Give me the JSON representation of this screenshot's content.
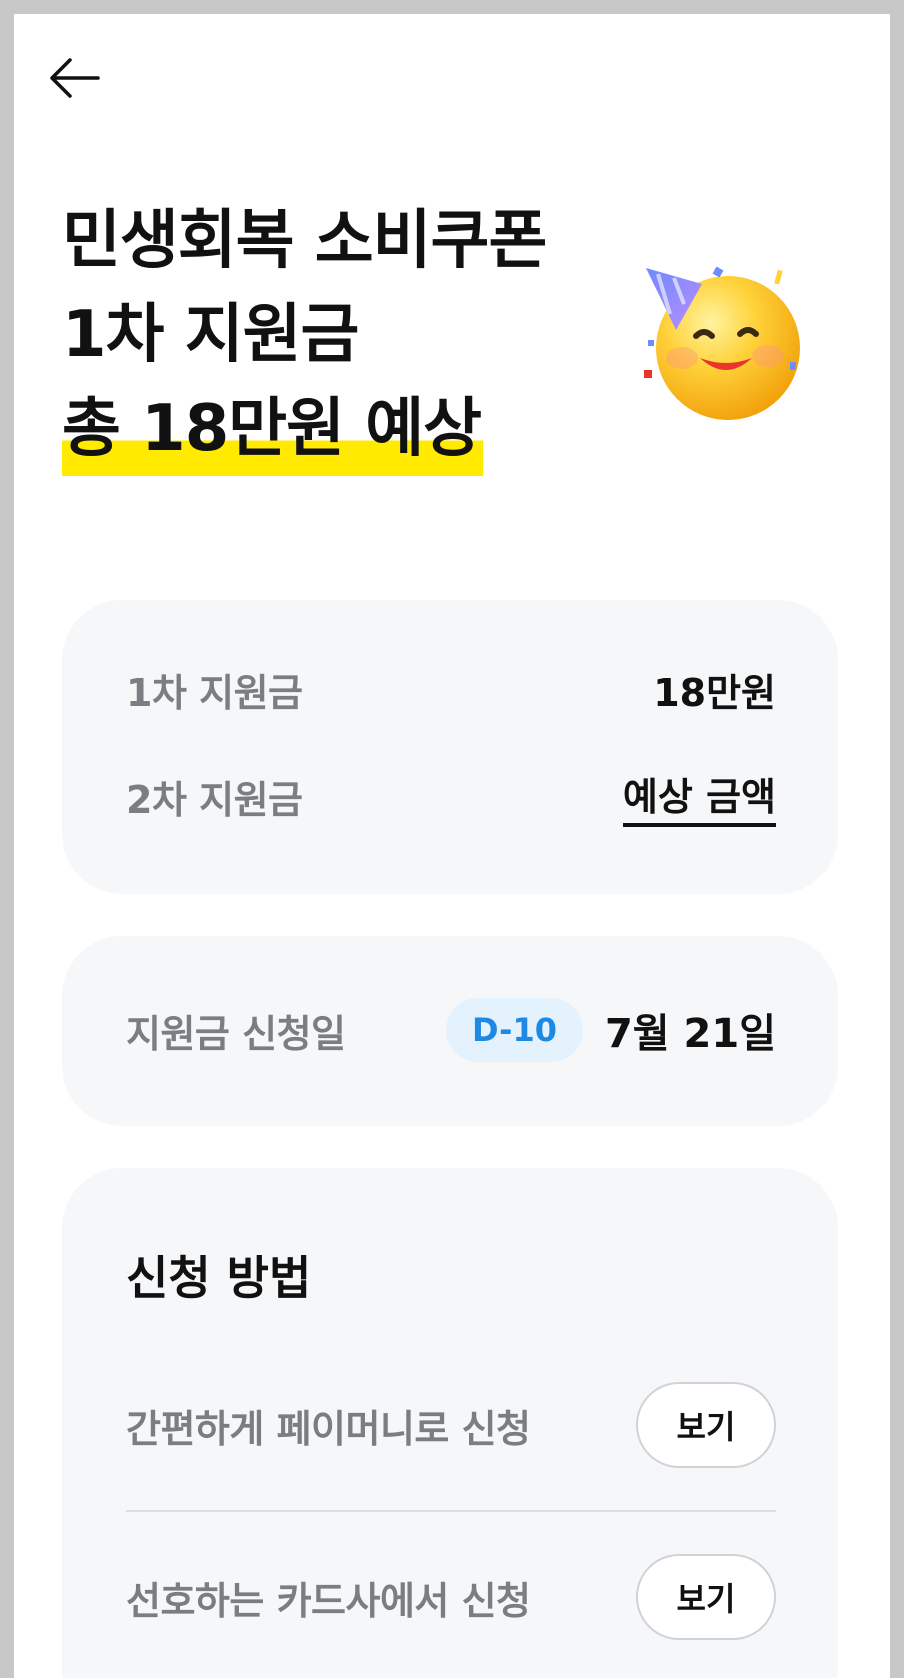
{
  "hero": {
    "title_line1": "민생회복 소비쿠폰",
    "title_line2": "1차 지원금",
    "title_line3": "총 18만원 예상"
  },
  "support": {
    "first_label": "1차 지원금",
    "first_value": "18만원",
    "second_label": "2차 지원금",
    "second_value": "예상 금액"
  },
  "apply_date": {
    "label": "지원금 신청일",
    "dday": "D-10",
    "date": "7월 21일"
  },
  "methods": {
    "title": "신청 방법",
    "items": [
      {
        "label": "간편하게 페이머니로 신청",
        "button": "보기"
      },
      {
        "label": "선호하는 카드사에서 신청",
        "button": "보기"
      }
    ]
  },
  "icons": {
    "back": "arrow-left-icon",
    "emoji": "party-face-emoji"
  },
  "colors": {
    "highlight": "#ffea00",
    "dday_bg": "#e3f2fd",
    "dday_text": "#1e88e5",
    "card_bg": "#f6f7f9"
  }
}
